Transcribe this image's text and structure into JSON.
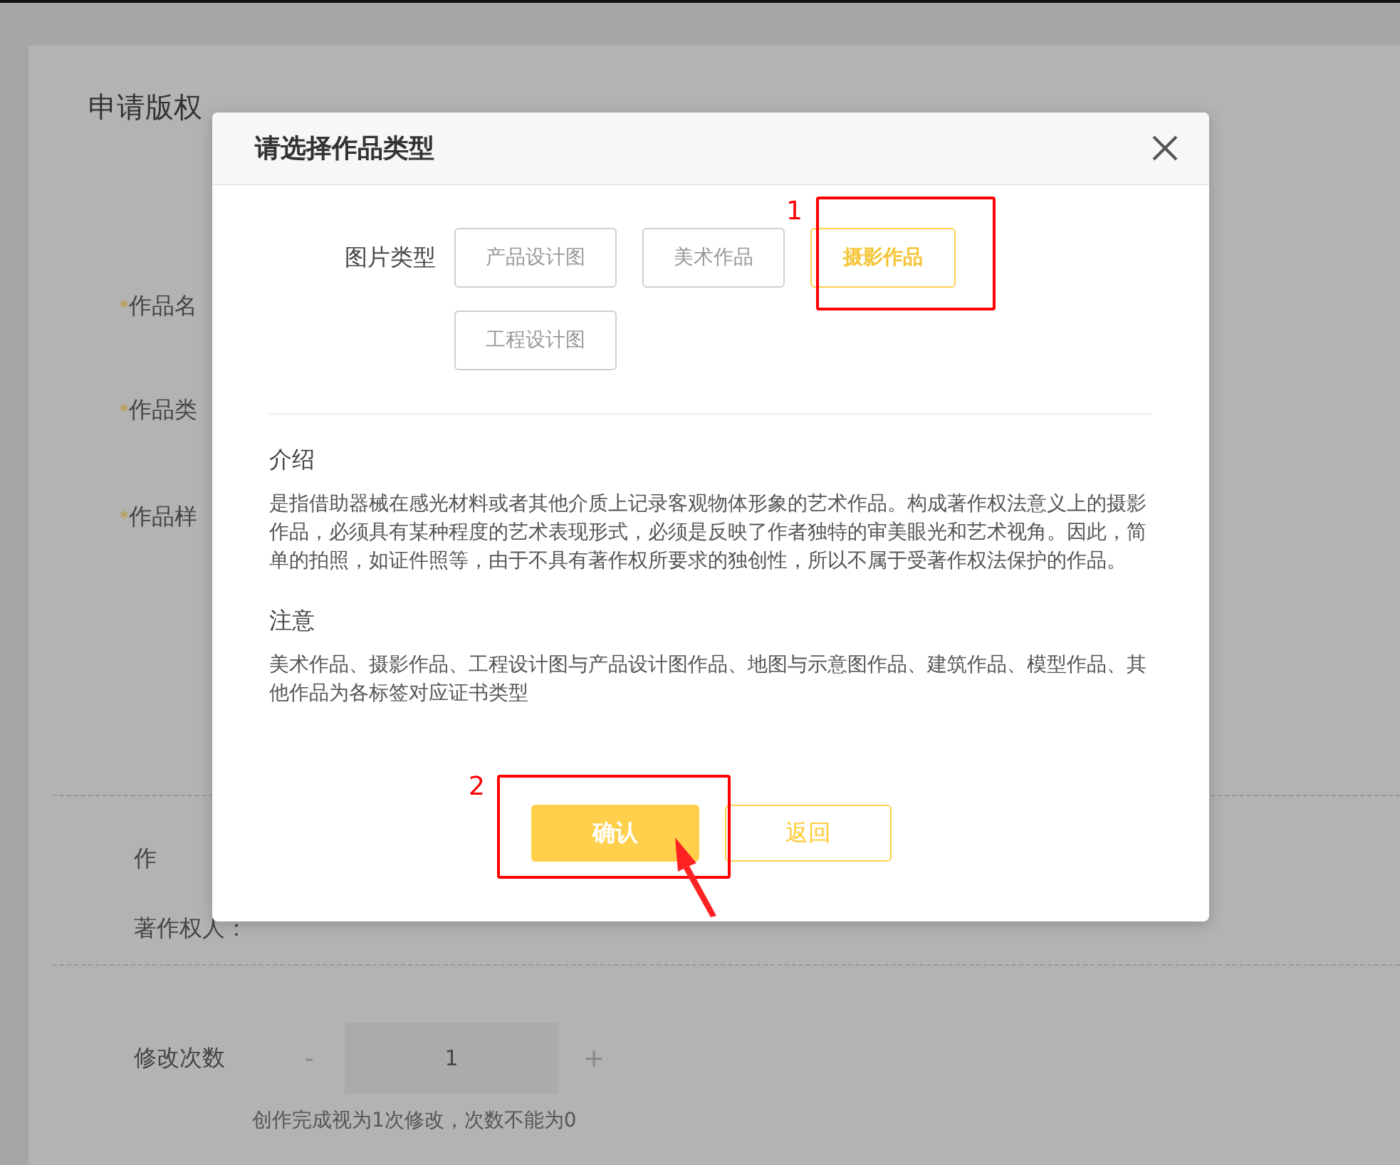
{
  "page": {
    "title": "申请版权",
    "fields": [
      {
        "mark": "*",
        "label": "作品名"
      },
      {
        "mark": "*",
        "label": "作品类"
      },
      {
        "mark": "*",
        "label": "作品样"
      }
    ],
    "author_row": [
      "作"
    ],
    "owner": {
      "label": "著作权人："
    },
    "revisions": {
      "label": "修改次数",
      "minus": "-",
      "value": "1",
      "plus": "+",
      "hint": "创作完成视为1次修改，次数不能为0"
    }
  },
  "dialog": {
    "title": "请选择作品类型",
    "type_label": "图片类型",
    "types": [
      {
        "label": "产品设计图",
        "selected": false
      },
      {
        "label": "美术作品",
        "selected": false
      },
      {
        "label": "摄影作品",
        "selected": true
      },
      {
        "label": "工程设计图",
        "selected": false
      }
    ],
    "sections": [
      {
        "heading": "介绍",
        "body": "是指借助器械在感光材料或者其他介质上记录客观物体形象的艺术作品。构成著作权法意义上的摄影作品，必须具有某种程度的艺术表现形式，必须是反映了作者独特的审美眼光和艺术视角。因此，简单的拍照，如证件照等，由于不具有著作权所要求的独创性，所以不属于受著作权法保护的作品。"
      },
      {
        "heading": "注意",
        "body": "美术作品、摄影作品、工程设计图与产品设计图作品、地图与示意图作品、建筑作品、模型作品、其他作品为各标签对应证书类型"
      }
    ],
    "confirm": "确认",
    "back": "返回"
  },
  "annotations": [
    {
      "number": "1"
    },
    {
      "number": "2"
    }
  ]
}
